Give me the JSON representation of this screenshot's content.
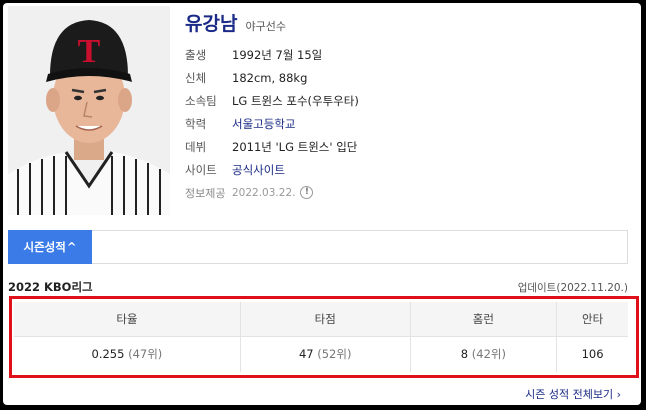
{
  "profile": {
    "name": "유강남",
    "job": "야구선수",
    "info": [
      {
        "label": "출생",
        "value": "1992년 7월 15일",
        "link": false
      },
      {
        "label": "신체",
        "value": "182cm, 88kg",
        "link": false
      },
      {
        "label": "소속팀",
        "value": "LG 트윈스 포수(우투우타)",
        "link": false
      },
      {
        "label": "학력",
        "value": "서울고등학교",
        "link": true
      },
      {
        "label": "데뷔",
        "value": "2011년 'LG 트윈스' 입단",
        "link": false
      },
      {
        "label": "사이트",
        "value": "공식사이트",
        "link": true
      }
    ],
    "source_label": "정보제공",
    "source_date": "2022.03.22.",
    "source_icon": "info-icon",
    "cap_letter": "T"
  },
  "season": {
    "tab_label": "시즌성적",
    "tab_icon": "chevron-up-icon",
    "league": "2022 KBO리그",
    "updated": "업데이트(2022.11.20.)",
    "headers": [
      "타율",
      "타점",
      "홈런",
      "안타"
    ],
    "values": [
      {
        "value": "0.255",
        "rank": "(47위)"
      },
      {
        "value": "47",
        "rank": "(52위)"
      },
      {
        "value": "8",
        "rank": "(42위)"
      },
      {
        "value": "106",
        "rank": ""
      }
    ],
    "more_label": "시즌 성적 전체보기",
    "more_icon": "chevron-right-icon"
  },
  "colors": {
    "accent": "#3b7be8",
    "name": "#1a2a86",
    "highlight": "#e0101a"
  }
}
